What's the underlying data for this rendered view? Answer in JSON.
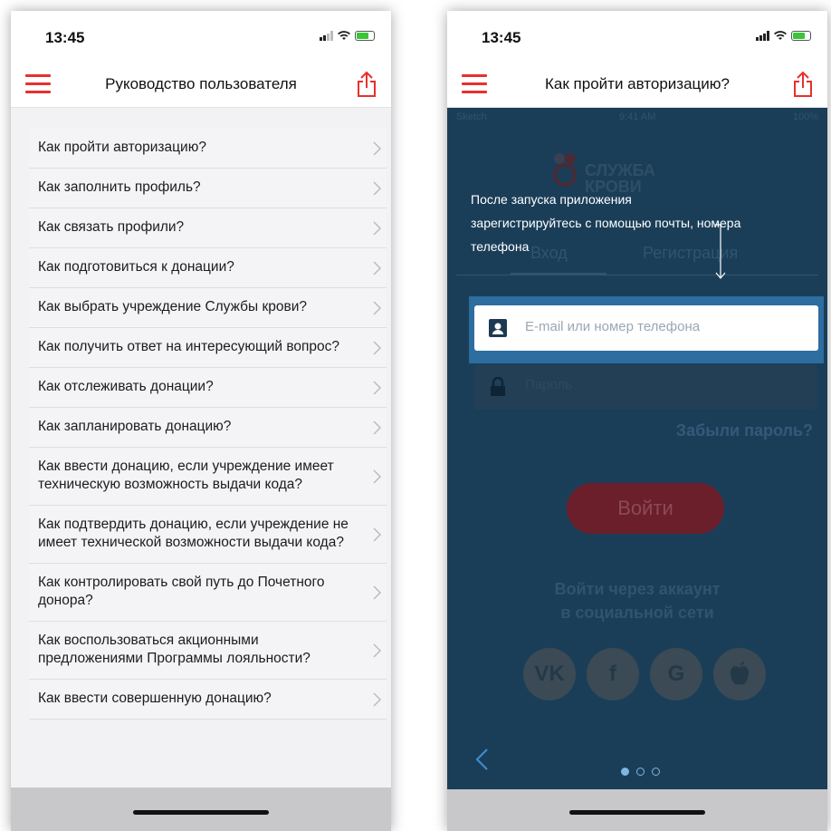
{
  "left": {
    "status_time": "13:45",
    "title": "Руководство пользователя",
    "items": [
      "Как пройти авторизацию?",
      "Как заполнить профиль?",
      "Как связать профили?",
      "Как подготовиться к донации?",
      "Как выбрать учреждение Службы крови?",
      "Как получить ответ на интересующий вопрос?",
      "Как отслеживать донации?",
      "Как запланировать донацию?",
      "Как ввести донацию, если учреждение имеет техническую возможность выдачи кода?",
      "Как подтвердить донацию, если учреждение не имеет технической возможности выдачи кода?",
      "Как контролировать свой путь до Почетного донора?",
      "Как воспользоваться акционными предложениями Программы лояльности?",
      "Как ввести совершенную донацию?"
    ]
  },
  "right": {
    "status_time": "13:45",
    "title": "Как пройти авторизацию?",
    "inner_status": {
      "carrier": "Sketch",
      "time": "9:41 AM",
      "battery": "100%"
    },
    "brand": {
      "line1": "СЛУЖБА",
      "line2": "КРОВИ"
    },
    "tabs": {
      "login": "Вход",
      "register": "Регистрация"
    },
    "hint": "После запуска приложения зарегистрируйтесь с помощью почты, номера телефона",
    "email_placeholder": "E-mail или номер телефона",
    "password_placeholder": "Пароль",
    "forgot": "Забыли пароль?",
    "login_button": "Войти",
    "social_text_1": "Войти через аккаунт",
    "social_text_2": "в социальной сети",
    "social": [
      "VK",
      "f",
      "G",
      ""
    ],
    "pager": {
      "count": 3,
      "active": 0
    }
  },
  "colors": {
    "accent": "#e8302c",
    "screen_bg": "#1b3e58",
    "highlight": "#2d6da0"
  }
}
